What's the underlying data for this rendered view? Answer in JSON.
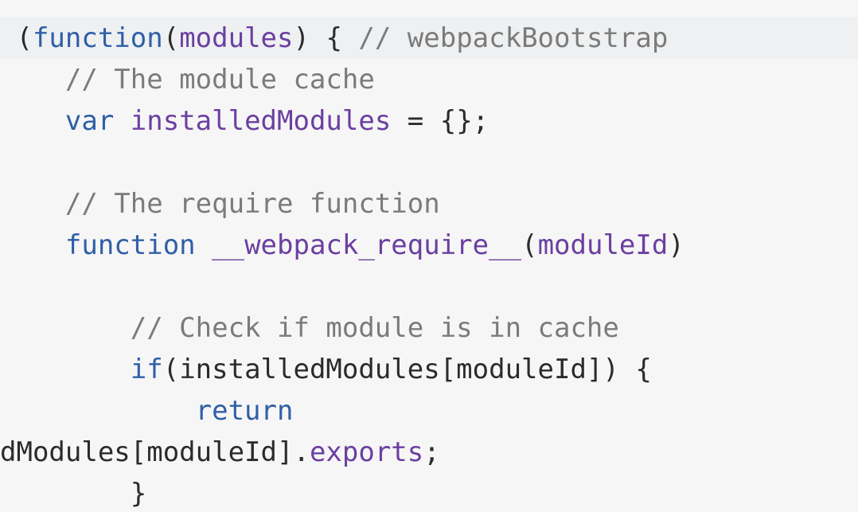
{
  "code": {
    "lines": [
      {
        "tokens": [
          {
            "text": " (",
            "cls": "plain"
          },
          {
            "text": "function",
            "cls": "kw"
          },
          {
            "text": "(",
            "cls": "plain"
          },
          {
            "text": "modules",
            "cls": "ident"
          },
          {
            "text": ") { ",
            "cls": "plain"
          },
          {
            "text": "// webpackBootstrap",
            "cls": "comment"
          }
        ],
        "highlighted": true
      },
      {
        "tokens": [
          {
            "text": "    ",
            "cls": "plain"
          },
          {
            "text": "// The module cache",
            "cls": "comment"
          }
        ],
        "highlighted": false
      },
      {
        "tokens": [
          {
            "text": "    ",
            "cls": "plain"
          },
          {
            "text": "var",
            "cls": "kw"
          },
          {
            "text": " ",
            "cls": "plain"
          },
          {
            "text": "installedModules",
            "cls": "ident"
          },
          {
            "text": " = {};",
            "cls": "plain"
          }
        ],
        "highlighted": false
      },
      {
        "tokens": [
          {
            "text": "",
            "cls": "plain"
          }
        ],
        "highlighted": false
      },
      {
        "tokens": [
          {
            "text": "    ",
            "cls": "plain"
          },
          {
            "text": "// The require function",
            "cls": "comment"
          }
        ],
        "highlighted": false
      },
      {
        "tokens": [
          {
            "text": "    ",
            "cls": "plain"
          },
          {
            "text": "function",
            "cls": "kw"
          },
          {
            "text": " ",
            "cls": "plain"
          },
          {
            "text": "__webpack_require__",
            "cls": "ident"
          },
          {
            "text": "(",
            "cls": "plain"
          },
          {
            "text": "moduleId",
            "cls": "ident"
          },
          {
            "text": ")",
            "cls": "plain"
          }
        ],
        "highlighted": false
      },
      {
        "tokens": [
          {
            "text": "",
            "cls": "plain"
          }
        ],
        "highlighted": false
      },
      {
        "tokens": [
          {
            "text": "        ",
            "cls": "plain"
          },
          {
            "text": "// Check if module is in cache",
            "cls": "comment"
          }
        ],
        "highlighted": false
      },
      {
        "tokens": [
          {
            "text": "        ",
            "cls": "plain"
          },
          {
            "text": "if",
            "cls": "kw"
          },
          {
            "text": "(installedModules[moduleId]) {",
            "cls": "plain"
          }
        ],
        "highlighted": false
      },
      {
        "tokens": [
          {
            "text": "            ",
            "cls": "plain"
          },
          {
            "text": "return",
            "cls": "kw"
          }
        ],
        "highlighted": false
      },
      {
        "tokens": [
          {
            "text": "dModules[moduleId].",
            "cls": "plain"
          },
          {
            "text": "exports",
            "cls": "prop"
          },
          {
            "text": ";",
            "cls": "plain"
          }
        ],
        "highlighted": false
      },
      {
        "tokens": [
          {
            "text": "        }",
            "cls": "plain"
          }
        ],
        "highlighted": false
      }
    ]
  }
}
